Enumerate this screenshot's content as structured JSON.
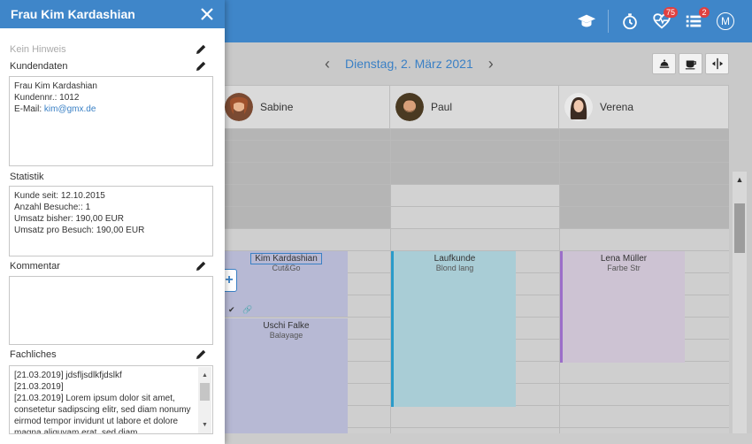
{
  "topbar": {
    "icons": [
      {
        "name": "graduation-cap-icon"
      },
      {
        "name": "stopwatch-icon"
      },
      {
        "name": "heartbeat-icon",
        "badge": "75"
      },
      {
        "name": "list-icon",
        "badge": "2"
      }
    ],
    "avatar_letter": "M"
  },
  "calendar": {
    "date": "Dienstag, 2. März 2021",
    "prev": "‹",
    "next": "›",
    "tools": [
      "reception-bell-icon",
      "cup-icon",
      "split-icon"
    ],
    "staff": [
      {
        "name": "Sabine"
      },
      {
        "name": "Paul"
      },
      {
        "name": "Verena"
      }
    ],
    "add_label": "+",
    "appointments": [
      {
        "client": "Kim Kardashian",
        "service": "Cut&Go",
        "color": "#b7b9d4"
      },
      {
        "client": "Uschi Falke",
        "service": "Balayage",
        "color": "#b7b9d4"
      },
      {
        "client": "Laufkunde",
        "service": "Blond lang",
        "color": "#a9cdd6",
        "accent": "#2a9bc9"
      },
      {
        "client": "Lena Müller",
        "service": "Farbe Str",
        "color": "#cdc3d3",
        "accent": "#9b6ec9"
      }
    ]
  },
  "panel": {
    "title": "Frau Kim Kardashian",
    "hint": "Kein Hinweis",
    "kundendaten": {
      "label": "Kundendaten",
      "name": "Frau Kim Kardashian",
      "kundennr": "Kundennr.: 1012",
      "email_label": "E-Mail: ",
      "email": "kim@gmx.de"
    },
    "statistik": {
      "label": "Statistik",
      "lines": [
        "Kunde seit: 12.10.2015",
        "Anzahl Besuche:: 1",
        "Umsatz bisher: 190,00 EUR",
        "Umsatz pro Besuch: 190,00 EUR"
      ]
    },
    "kommentar": {
      "label": "Kommentar",
      "text": ""
    },
    "fachliches": {
      "label": "Fachliches",
      "lines": [
        "[21.03.2019] jdsfljsdlkfjdslkf",
        "[21.03.2019]",
        "[21.03.2019] Lorem ipsum dolor sit amet, consetetur sadipscing elitr, sed diam nonumy eirmod tempor invidunt ut labore et dolore magna aliquyam erat, sed diam"
      ]
    }
  }
}
